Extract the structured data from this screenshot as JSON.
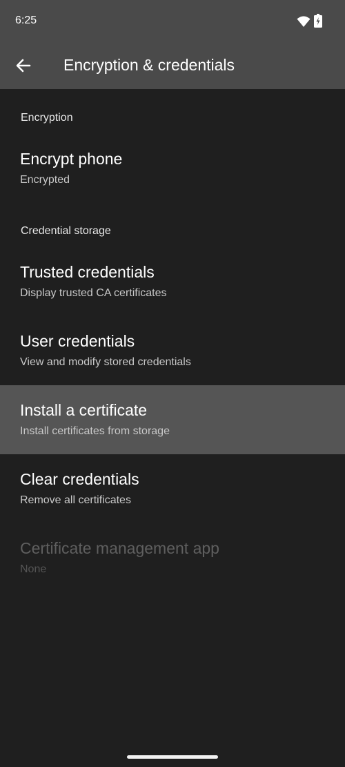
{
  "status_bar": {
    "time": "6:25",
    "wifi_icon": "wifi-icon",
    "battery_icon": "battery-charging-icon"
  },
  "app_bar": {
    "back_icon": "arrow-back-icon",
    "title": "Encryption & credentials"
  },
  "sections": {
    "encryption": {
      "header": "Encryption",
      "items": [
        {
          "title": "Encrypt phone",
          "subtitle": "Encrypted"
        }
      ]
    },
    "credential_storage": {
      "header": "Credential storage",
      "items": [
        {
          "title": "Trusted credentials",
          "subtitle": "Display trusted CA certificates"
        },
        {
          "title": "User credentials",
          "subtitle": "View and modify stored credentials"
        },
        {
          "title": "Install a certificate",
          "subtitle": "Install certificates from storage"
        },
        {
          "title": "Clear credentials",
          "subtitle": "Remove all certificates"
        },
        {
          "title": "Certificate management app",
          "subtitle": "None"
        }
      ]
    }
  },
  "colors": {
    "background": "#1f1f1f",
    "app_bar": "#4a4a4a",
    "highlight": "#555555"
  }
}
